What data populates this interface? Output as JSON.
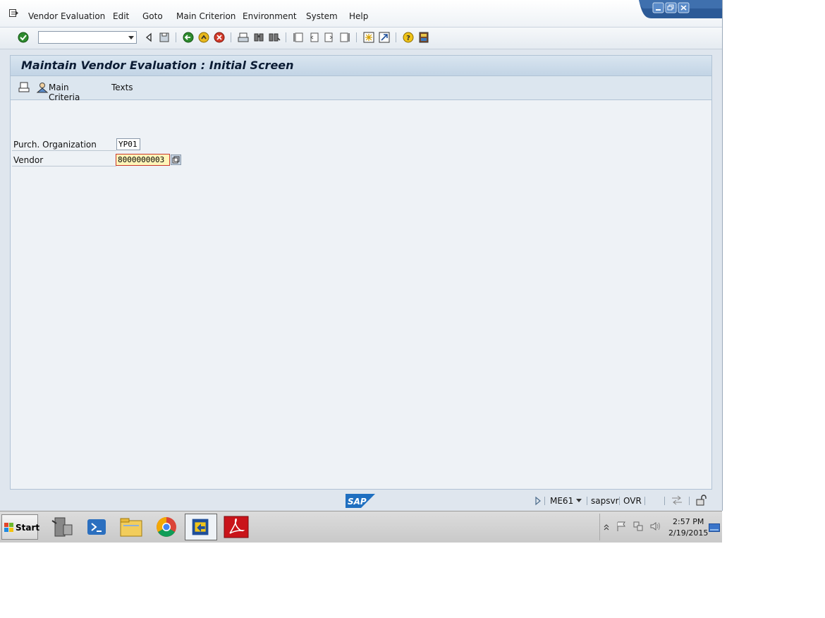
{
  "menubar": {
    "items": [
      "Vendor Evaluation",
      "Edit",
      "Goto",
      "Main Criterion",
      "Environment",
      "System",
      "Help"
    ]
  },
  "toolbar": {
    "command_field_value": "",
    "icons": [
      "enter-icon",
      "back-arrow-icon",
      "save-icon",
      "back-icon",
      "exit-icon",
      "cancel-icon",
      "print-icon",
      "find-icon",
      "find-next-icon",
      "first-page-icon",
      "previous-page-icon",
      "next-page-icon",
      "last-page-icon",
      "create-session-icon",
      "shortcut-icon",
      "help-icon",
      "customize-layout-icon"
    ]
  },
  "page": {
    "title": "Maintain Vendor Evaluation : Initial Screen"
  },
  "app_toolbar": {
    "main_criteria_label": "Main Criteria",
    "texts_label": "Texts"
  },
  "form": {
    "purch_org_label": "Purch. Organization",
    "purch_org_value": "YP01",
    "vendor_label": "Vendor",
    "vendor_value": "8000000003"
  },
  "statusbar": {
    "logo": "SAP",
    "transaction": "ME61",
    "server": "sapsvr",
    "mode": "OVR"
  },
  "taskbar": {
    "start_label": "Start",
    "time": "2:57 PM",
    "date": "2/19/2015"
  },
  "colors": {
    "title_bg": "#c2d4e5",
    "content_bg": "#eef2f6",
    "vendor_field_bg": "#fff5b8",
    "sap_blue": "#1f6fc0"
  }
}
